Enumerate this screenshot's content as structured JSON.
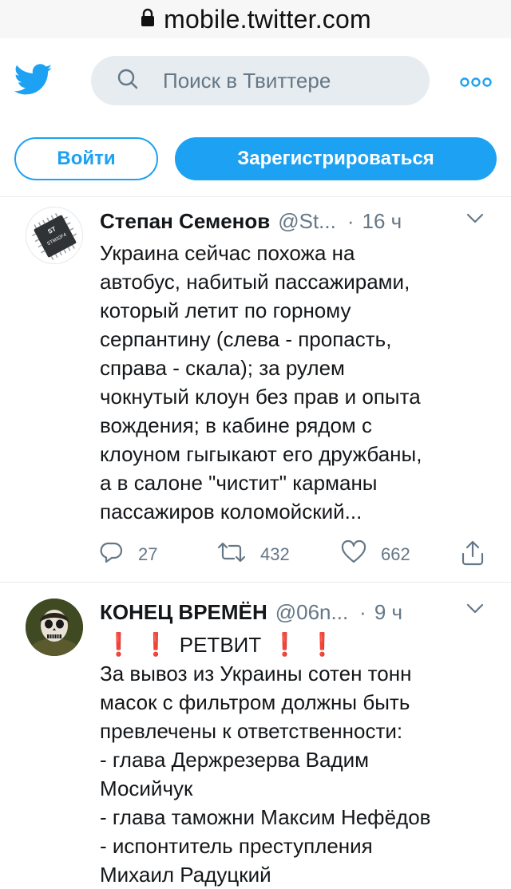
{
  "browser": {
    "url": "mobile.twitter.com"
  },
  "header": {
    "search_placeholder": "Поиск в Твиттере"
  },
  "auth": {
    "login_label": "Войти",
    "signup_label": "Зарегистрироваться"
  },
  "tweets": [
    {
      "name": "Степан Семенов",
      "handle": "@St...",
      "dot": "·",
      "time": "16 ч",
      "lines": [
        "Украина сейчас похожа на",
        "автобус, набитый пассажирами,",
        "который летит по горному",
        "серпантину (слева - пропасть,",
        "справа - скала); за рулем",
        "чокнутый клоун без прав и опыта",
        "вождения; в кабине рядом с",
        "клоуном гыгыкают его дружбаны,",
        "а в салоне \"чистит\" карманы",
        "пассажиров коломойский..."
      ],
      "replies": "27",
      "retweets": "432",
      "likes": "662",
      "avatar_text": "STM32F4"
    },
    {
      "name": "КОНЕЦ ВРЕМЁН",
      "handle": "@06n...",
      "dot": "·",
      "time": "9 ч",
      "retweet_marks": "❗",
      "retweet_word": "РЕТВИТ",
      "lines": [
        "За вывоз из Украины сотен тонн",
        "масок с фильтром должны быть",
        "превлечены к ответственности:",
        "- глава Держрезерва Вадим",
        "Мосийчук",
        "- глава таможни Максим Нефёдов",
        "- испонтитель преступления",
        "Михаил Радуцкий"
      ]
    }
  ],
  "colors": {
    "accent": "#1da1f2",
    "muted": "#657786",
    "red": "#e0245e"
  }
}
